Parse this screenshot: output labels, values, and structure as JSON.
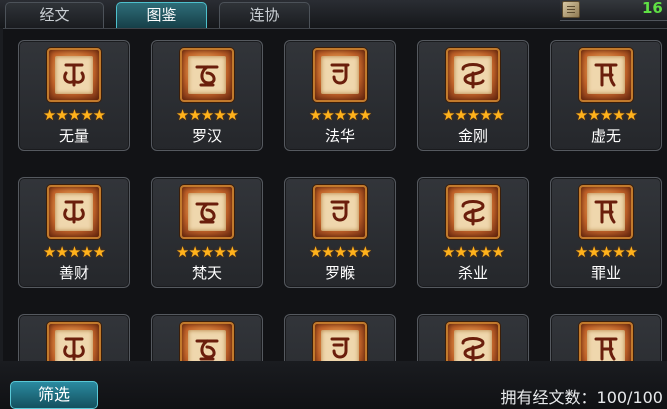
{
  "tabs": [
    {
      "label": "经文",
      "active": false
    },
    {
      "label": "图鉴",
      "active": true
    },
    {
      "label": "连协",
      "active": false
    }
  ],
  "counter": {
    "icon": "scroll-icon",
    "text": "16"
  },
  "cards": [
    {
      "name": "无量",
      "stars": 5,
      "glyph": "ra"
    },
    {
      "name": "罗汉",
      "stars": 5,
      "glyph": "ka"
    },
    {
      "name": "法华",
      "stars": 5,
      "glyph": "ja"
    },
    {
      "name": "金刚",
      "stars": 5,
      "glyph": "da"
    },
    {
      "name": "虚无",
      "stars": 5,
      "glyph": "ya"
    },
    {
      "name": "善财",
      "stars": 5,
      "glyph": "la"
    },
    {
      "name": "梵天",
      "stars": 5,
      "glyph": "om"
    },
    {
      "name": "罗睺",
      "stars": 5,
      "glyph": "hum"
    },
    {
      "name": "杀业",
      "stars": 5,
      "glyph": "sa"
    },
    {
      "name": "罪业",
      "stars": 5,
      "glyph": "ha"
    },
    {
      "name": "",
      "stars": 0,
      "glyph": "ta"
    },
    {
      "name": "",
      "stars": 0,
      "glyph": "pa"
    },
    {
      "name": "",
      "stars": 0,
      "glyph": "ma"
    },
    {
      "name": "",
      "stars": 0,
      "glyph": "na"
    },
    {
      "name": "",
      "stars": 0,
      "glyph": "va"
    }
  ],
  "star_char": "★",
  "star_color": "#ffb21c",
  "accent_color": "#4ec0cc",
  "filter_label": "筛选",
  "owned_label": "拥有经文数：100/100"
}
